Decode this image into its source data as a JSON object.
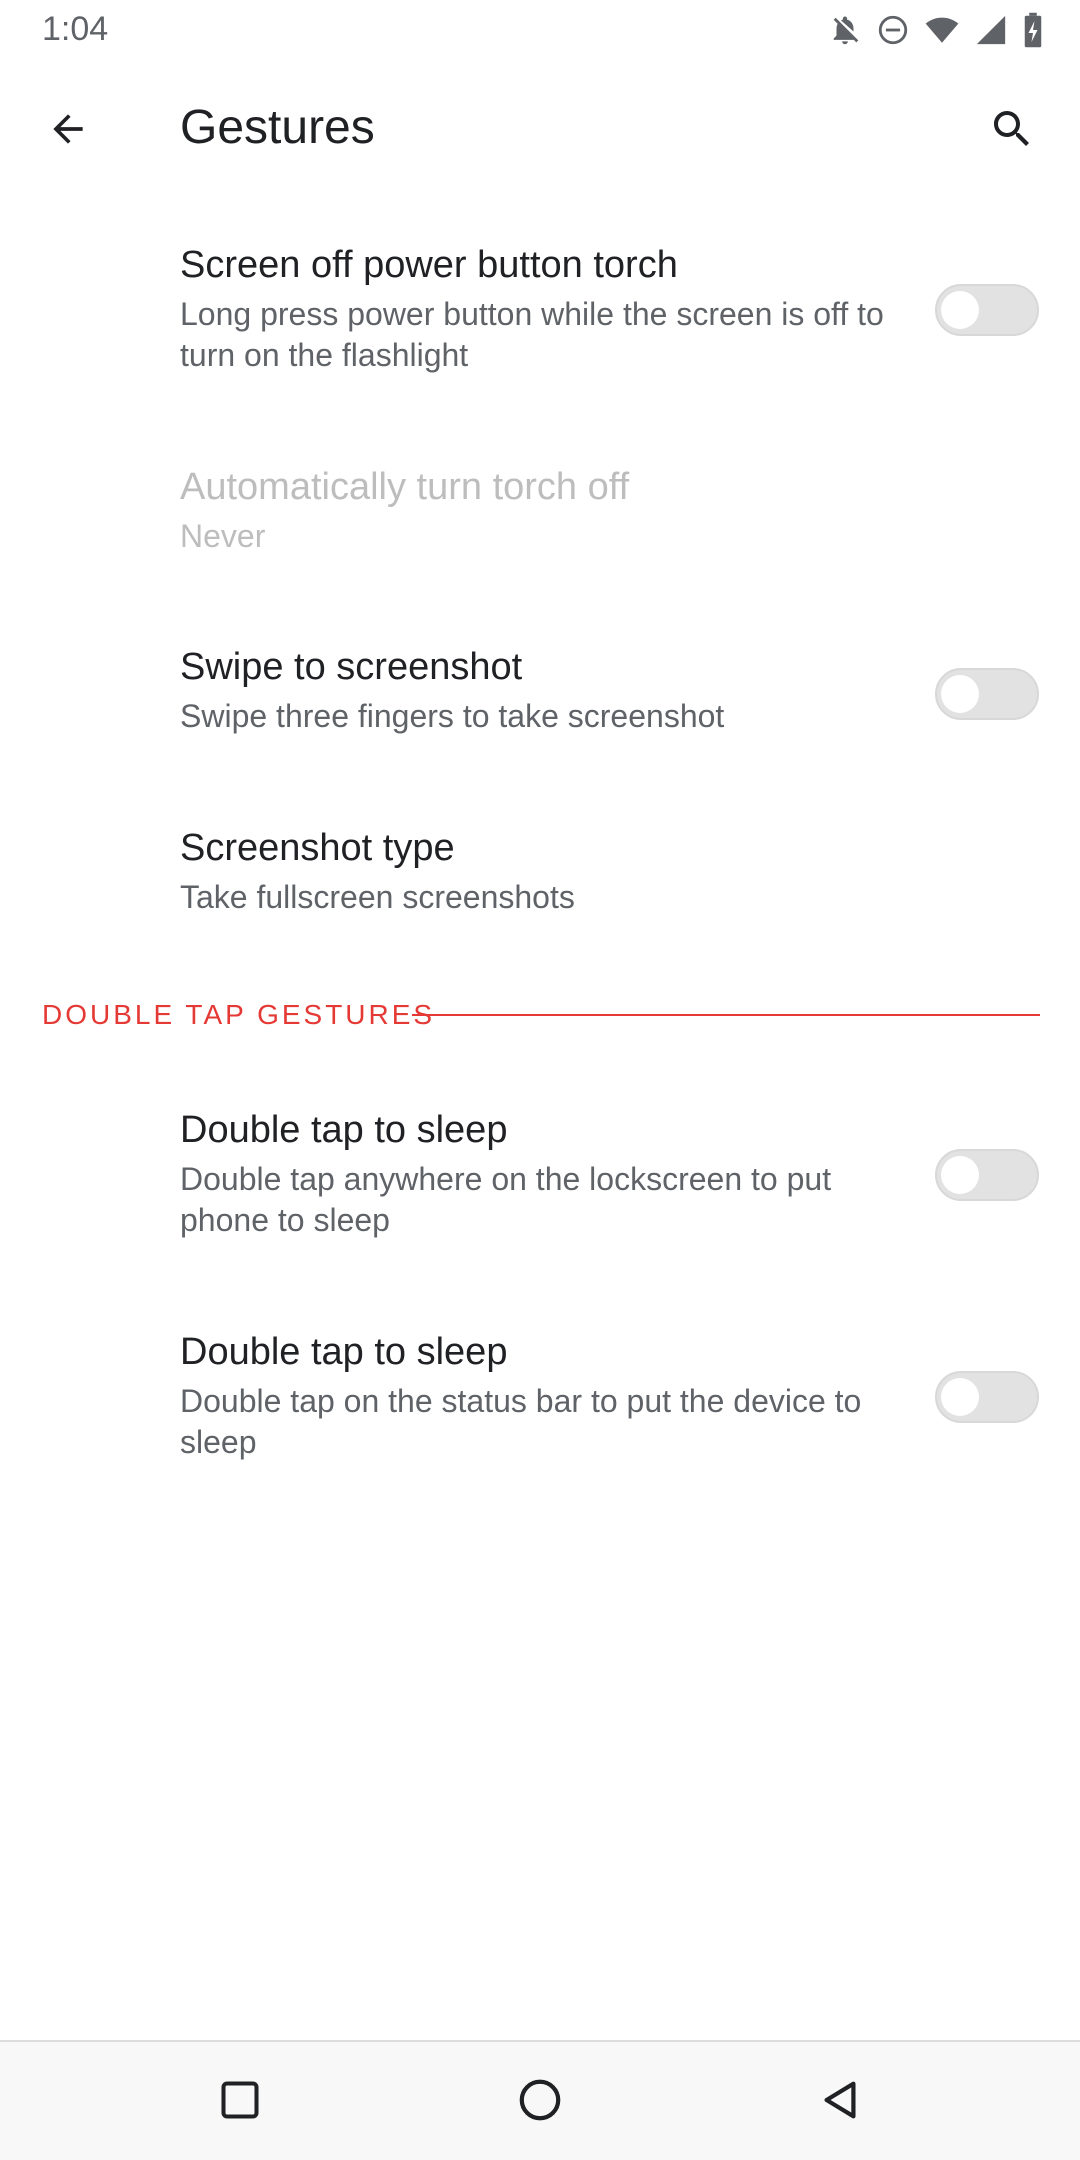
{
  "status_bar": {
    "time": "1:04",
    "icons": [
      "notifications-off-icon",
      "do-not-disturb-icon",
      "wifi-icon",
      "cell-signal-icon",
      "battery-charging-icon"
    ]
  },
  "app_bar": {
    "title": "Gestures",
    "back_icon": "arrow-back-icon",
    "search_icon": "search-icon"
  },
  "preferences": [
    {
      "title": "Screen off power button torch",
      "summary": "Long press power button while the screen is off to turn on the flashlight",
      "toggle": false
    },
    {
      "title": "Automatically turn torch off",
      "summary": "Never",
      "enabled": false
    },
    {
      "title": "Swipe to screenshot",
      "summary": "Swipe three fingers to take screenshot",
      "toggle": false
    },
    {
      "title": "Screenshot type",
      "summary": "Take fullscreen screenshots"
    }
  ],
  "double_tap_category": {
    "label": "DOUBLE TAP GESTURES",
    "accent_color": "#e53935",
    "items": [
      {
        "title": "Double tap to sleep",
        "summary": "Double tap anywhere on the lockscreen to put phone to sleep",
        "toggle": false
      },
      {
        "title": "Double tap to sleep",
        "summary": "Double tap on the status bar to put the device to sleep",
        "toggle": false
      }
    ]
  },
  "nav_bar": {
    "icons": [
      "recents-icon",
      "home-icon",
      "back-icon"
    ]
  }
}
